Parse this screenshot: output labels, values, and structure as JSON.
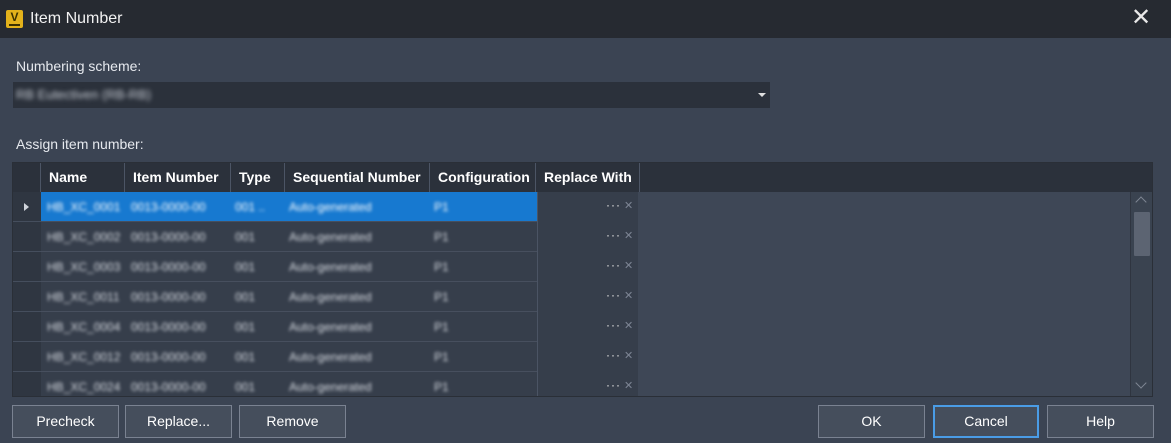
{
  "window": {
    "title": "Item Number",
    "app_icon_letter": "V",
    "close_glyph": "✕"
  },
  "numbering_scheme": {
    "label": "Numbering scheme:",
    "value": "RB Eutectiven (RB-RB)"
  },
  "assign": {
    "label": "Assign item number:"
  },
  "grid": {
    "columns": [
      "Name",
      "Item Number",
      "Type",
      "Sequential Number",
      "Configuration",
      "Replace With"
    ],
    "rows": [
      {
        "name": "HB_XC_0001",
        "item_number": "0013-0000-00",
        "type": "001 ..",
        "sequential": "Auto-generated",
        "configuration": "P1",
        "selected": true
      },
      {
        "name": "HB_XC_0002",
        "item_number": "0013-0000-00",
        "type": "001",
        "sequential": "Auto-generated",
        "configuration": "P1",
        "selected": false
      },
      {
        "name": "HB_XC_0003",
        "item_number": "0013-0000-00",
        "type": "001",
        "sequential": "Auto-generated",
        "configuration": "P1",
        "selected": false
      },
      {
        "name": "HB_XC_0011",
        "item_number": "0013-0000-00",
        "type": "001",
        "sequential": "Auto-generated",
        "configuration": "P1",
        "selected": false
      },
      {
        "name": "HB_XC_0004",
        "item_number": "0013-0000-00",
        "type": "001",
        "sequential": "Auto-generated",
        "configuration": "P1",
        "selected": false
      },
      {
        "name": "HB_XC_0012",
        "item_number": "0013-0000-00",
        "type": "001",
        "sequential": "Auto-generated",
        "configuration": "P1",
        "selected": false
      },
      {
        "name": "HB_XC_0024",
        "item_number": "0013-0000-00",
        "type": "001",
        "sequential": "Auto-generated",
        "configuration": "P1",
        "selected": false
      }
    ],
    "replace_ellipsis": "···",
    "replace_clear": "✕"
  },
  "buttons": {
    "precheck": "Precheck",
    "replace": "Replace...",
    "remove": "Remove",
    "ok": "OK",
    "cancel": "Cancel",
    "help": "Help"
  },
  "colors": {
    "background": "#3b4453",
    "titlebar": "#262a31",
    "selection": "#1779d0",
    "app_icon": "#e3b21b",
    "focus_border": "#4a9ce6"
  }
}
